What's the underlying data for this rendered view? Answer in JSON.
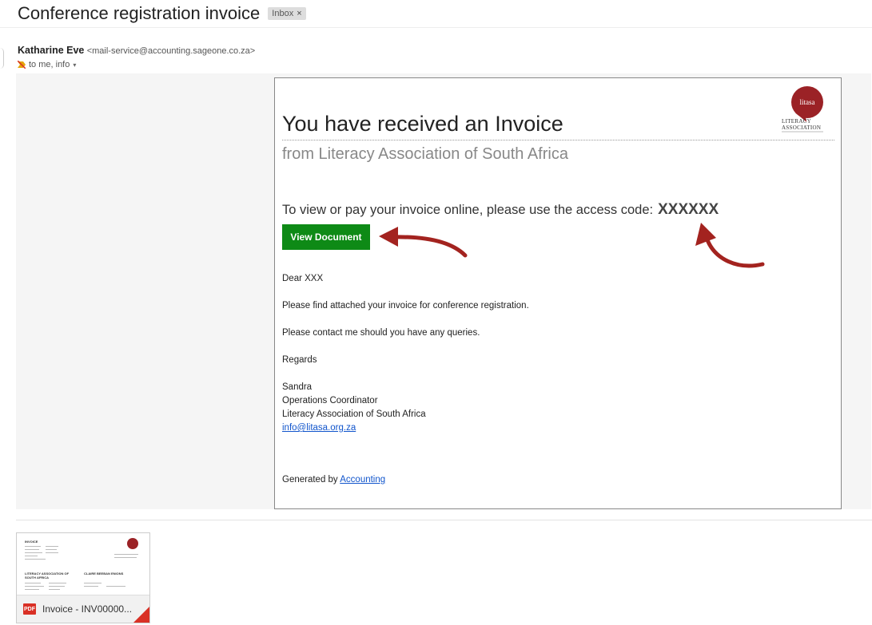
{
  "email": {
    "subject": "Conference registration invoice",
    "label": "Inbox",
    "label_close": "×",
    "sender_name": "Katharine Eve",
    "sender_address": "<mail-service@accounting.sageone.co.za>",
    "recipients": "to me, info",
    "recipients_caret": "▾"
  },
  "invoice": {
    "logo_text": "litasa",
    "logo_line1": "LITERACY",
    "logo_line2": "ASSOCIATION",
    "title": "You have received an Invoice",
    "from": "from Literacy Association of South Africa",
    "access_prompt": "To view or pay your invoice online, please use the access code:",
    "access_code": "XXXXXX",
    "view_button": "View Document",
    "greeting": "Dear XXX",
    "paragraph1": "Please find attached your invoice for conference registration.",
    "paragraph2": "Please contact me should you have any queries.",
    "regards": "Regards",
    "sig_name": "Sandra",
    "sig_title": "Operations Coordinator",
    "sig_org": "Literacy Association of South Africa",
    "sig_email": "info@litasa.org.za",
    "generated_prefix": "Generated by",
    "generated_link": "Accounting"
  },
  "attachment": {
    "type_badge": "PDF",
    "name": "Invoice - INV00000...",
    "thumb_heading": "INVOICE",
    "thumb_from": "LITERACY ASSOCIATION OF SOUTH AFRICA",
    "thumb_to": "CLAIRE BEEBAN ENIONS"
  },
  "colors": {
    "button_green": "#0e8a16",
    "arrow_red": "#a3231f",
    "logo_red": "#9b2226",
    "link_blue": "#1155cc"
  }
}
